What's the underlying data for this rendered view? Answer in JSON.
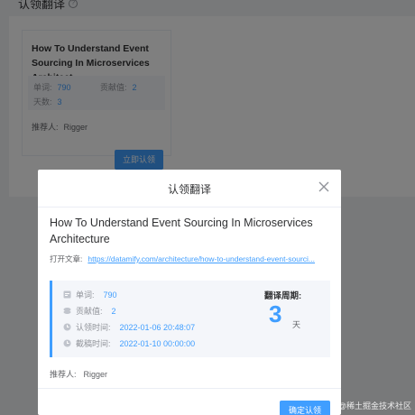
{
  "background": {
    "page_title": "认领翻译",
    "help_icon": "question-circle-icon",
    "card": {
      "title": "How To Understand Event Sourcing In Microservices Architect...",
      "words_label": "单词:",
      "words_value": "790",
      "contribution_label": "贡献值:",
      "contribution_value": "2",
      "days_label": "天数:",
      "days_value": "3",
      "recommender_label": "推荐人:",
      "recommender_name": "Rigger",
      "claim_label": "立即认领"
    }
  },
  "dialog": {
    "title": "认领翻译",
    "close_icon": "close-icon",
    "article_title": "How To Understand Event Sourcing In Microservices Architecture",
    "open_label": "打开文章:",
    "open_url": "https://datamify.com/architecture/how-to-understand-event-sourci...",
    "info": {
      "words_label": "单词:",
      "words_value": "790",
      "contribution_label": "贡献值:",
      "contribution_value": "2",
      "claim_time_label": "认领时间:",
      "claim_time_value": "2022-01-06 20:48:07",
      "deadline_label": "截稿时间:",
      "deadline_value": "2022-01-10 00:00:00",
      "cycle_label": "翻译周期:",
      "cycle_value": "3",
      "cycle_unit": "天"
    },
    "recommender_label": "推荐人:",
    "recommender_name": "Rigger",
    "confirm_label": "确定认领"
  },
  "watermark": "@稀土掘金技术社区",
  "colors": {
    "primary": "#409eff",
    "overlay": "rgba(0,0,0,0.5)",
    "info_bg": "#f4f6fa"
  }
}
